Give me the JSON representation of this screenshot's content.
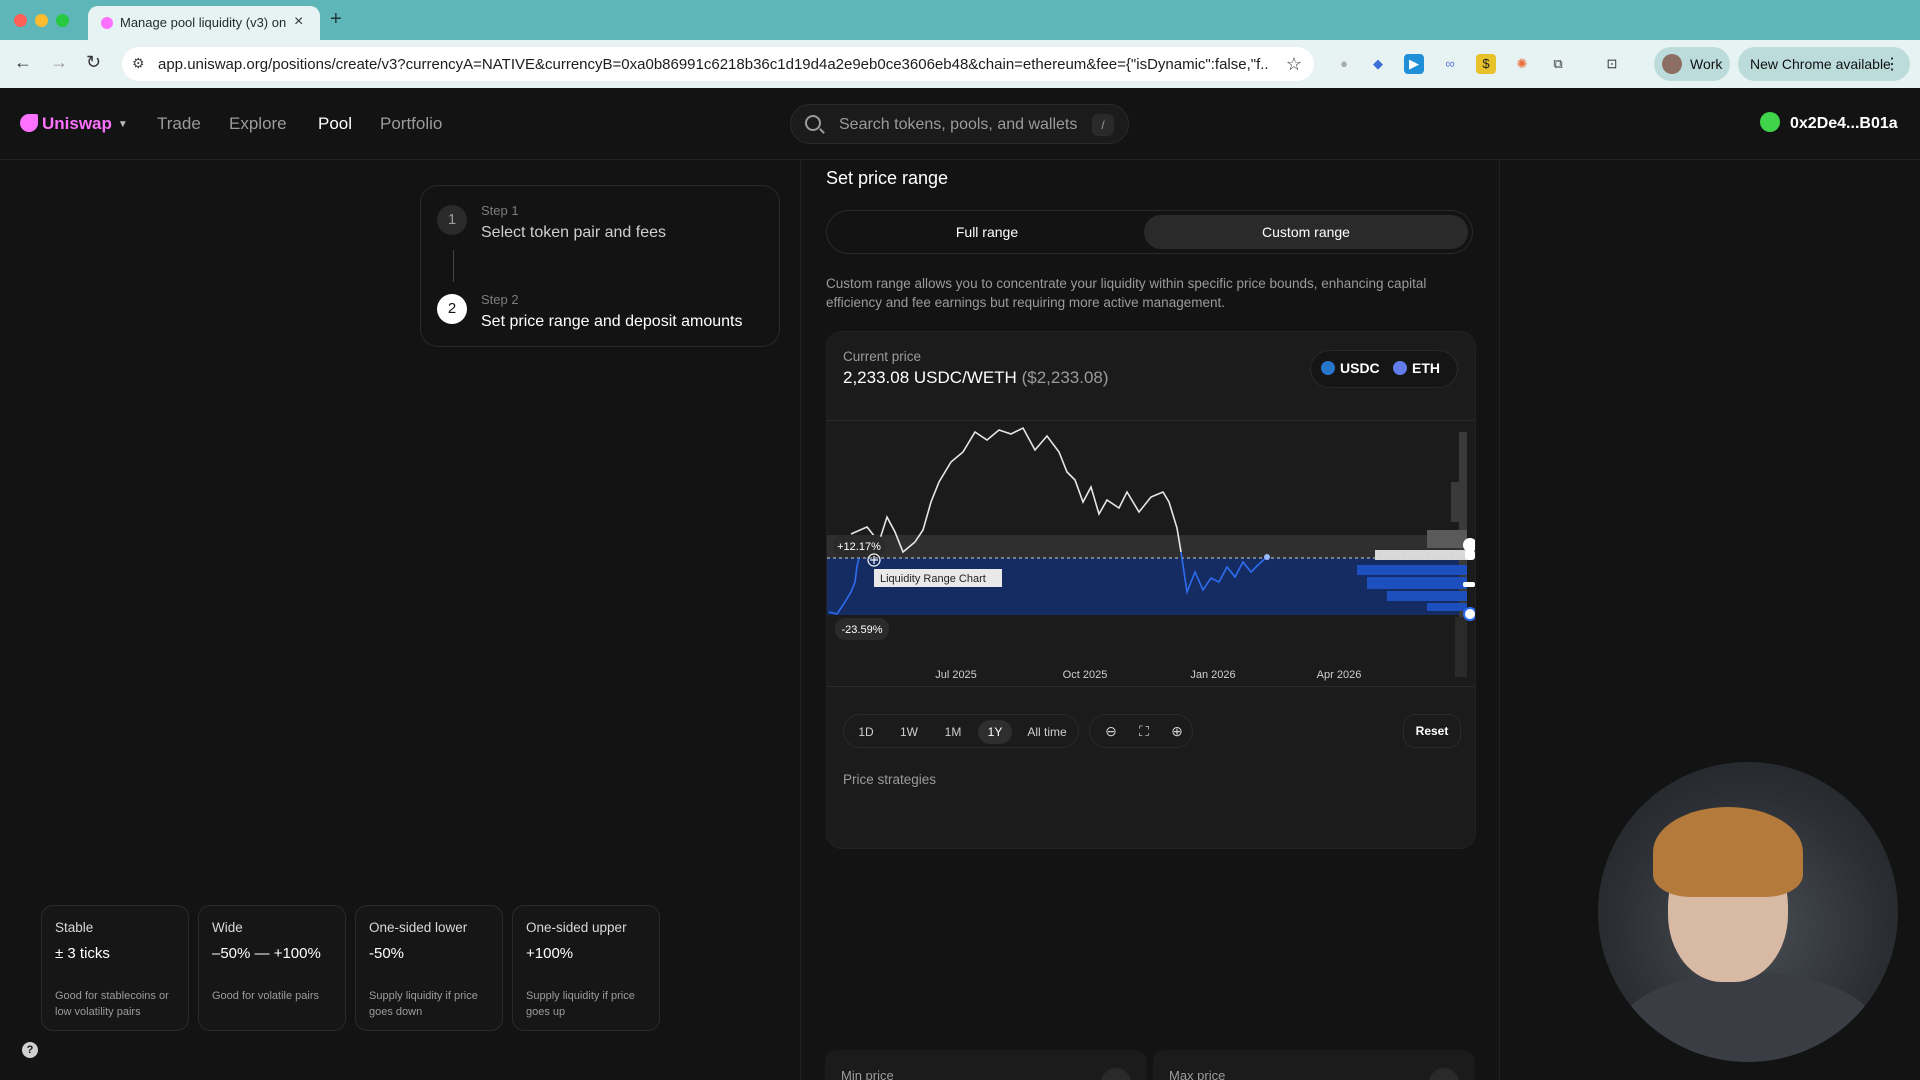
{
  "browser": {
    "tab_title": "Manage pool liquidity (v3) on",
    "url": "app.uniswap.org/positions/create/v3?currencyA=NATIVE&currencyB=0xa0b86991c6218b36c1d19d4a2e9eb0ce3606eb48&chain=ethereum&fee={\"isDynamic\":false,\"f...",
    "profile_label": "Work",
    "update_label": "New Chrome available"
  },
  "header": {
    "brand": "Uniswap",
    "nav": [
      "Trade",
      "Explore",
      "Pool",
      "Portfolio"
    ],
    "active_nav": "Pool",
    "search_placeholder": "Search tokens, pools, and wallets",
    "search_shortcut": "/",
    "wallet": "0x2De4...B01a"
  },
  "steps": [
    {
      "num": "1",
      "label": "Step 1",
      "title": "Select token pair and fees"
    },
    {
      "num": "2",
      "label": "Step 2",
      "title": "Set price range and deposit amounts"
    }
  ],
  "price_range": {
    "title": "Set price range",
    "options": [
      "Full range",
      "Custom range"
    ],
    "selected": "Custom range",
    "description": "Custom range allows you to concentrate your liquidity within specific price bounds, enhancing capital efficiency and fee earnings but requiring more active management."
  },
  "current_price": {
    "label": "Current price",
    "value": "2,233.08 USDC/WETH",
    "usd": "($2,233.08)",
    "tokens": [
      "USDC",
      "ETH"
    ]
  },
  "chart": {
    "upper_pct": "+12.17%",
    "lower_pct": "-23.59%",
    "tooltip": "Liquidity Range Chart",
    "x_ticks": [
      "Jul 2025",
      "Oct 2025",
      "Jan 2026",
      "Apr 2026"
    ]
  },
  "chart_data": {
    "type": "line",
    "x_ticks": [
      "Jul 2025",
      "Oct 2025",
      "Jan 2026",
      "Apr 2026"
    ],
    "series": [
      {
        "values": [
          1800,
          2500,
          2450,
          2600,
          3700,
          4600,
          4650,
          4300,
          4500,
          4000,
          3700,
          4000,
          3900,
          3400,
          3000,
          2900,
          2950,
          3150,
          3250,
          3200,
          2700,
          2300,
          2200,
          2400,
          2300,
          2233
        ]
      }
    ],
    "range_upper_pct": 12.17,
    "range_lower_pct": -23.59,
    "current_price": 2233.08
  },
  "controls": {
    "timeframes": [
      "1D",
      "1W",
      "1M",
      "1Y",
      "All time"
    ],
    "active_timeframe": "1Y",
    "zoom_out": "⊖",
    "fit": "⛶",
    "zoom_in": "⊕",
    "reset": "Reset"
  },
  "strategies": {
    "title": "Price strategies",
    "items": [
      {
        "name": "Stable",
        "value": "± 3 ticks",
        "desc": "Good for stablecoins or low volatility pairs"
      },
      {
        "name": "Wide",
        "value": "–50% — +100%",
        "desc": "Good for volatile pairs"
      },
      {
        "name": "One-sided lower",
        "value": "-50%",
        "desc": "Supply liquidity if price goes down"
      },
      {
        "name": "One-sided upper",
        "value": "+100%",
        "desc": "Supply liquidity if price goes up"
      }
    ]
  },
  "minmax": {
    "min_label": "Min price",
    "max_label": "Max price"
  },
  "help": "?",
  "colors": {
    "accent": "#fc72ff",
    "range_blue": "#1e4fbf",
    "line_blue": "#2f6df0"
  }
}
